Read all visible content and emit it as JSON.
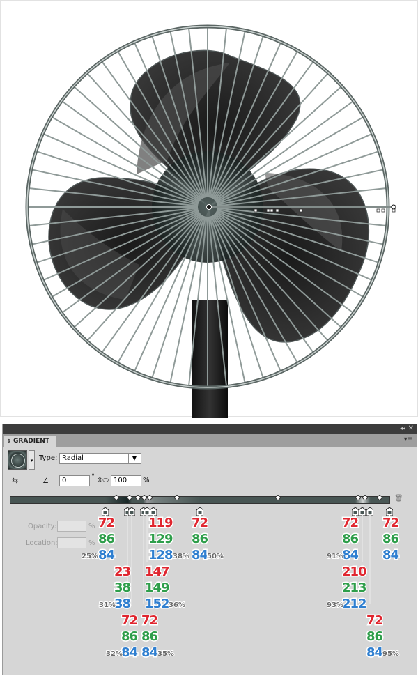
{
  "panel": {
    "tab_label": "GRADIENT",
    "type_label": "Type:",
    "type_value": "Radial",
    "angle_value": "0",
    "degree_sign": "°",
    "aspect_value": "100",
    "percent_sign": "%",
    "opacity_label": "Opacity:",
    "location_label": "Location:",
    "opacity_unit": "%",
    "location_unit": "%"
  },
  "stops": [
    {
      "r": "72",
      "g": "86",
      "b": "84",
      "pct": "25%"
    },
    {
      "r": "23",
      "g": "38",
      "b": "38",
      "pct": "31%"
    },
    {
      "r": "72",
      "g": "86",
      "b": "84",
      "pct": "32%"
    },
    {
      "r": "72",
      "g": "86",
      "b": "84",
      "pct": "35%"
    },
    {
      "r": "147",
      "g": "149",
      "b": "152",
      "pct": "36%"
    },
    {
      "r": "119",
      "g": "129",
      "b": "128",
      "pct": "38%"
    },
    {
      "r": "72",
      "g": "86",
      "b": "84",
      "pct": "50%"
    },
    {
      "r": "72",
      "g": "86",
      "b": "84",
      "pct": "91%"
    },
    {
      "r": "210",
      "g": "213",
      "b": "212",
      "pct": "93%"
    },
    {
      "r": "72",
      "g": "86",
      "b": "84",
      "pct": "95%"
    },
    {
      "r": "72",
      "g": "86",
      "b": "84",
      "pct": ""
    }
  ],
  "colors": {
    "red": "#e0262f",
    "green": "#2e9e4a",
    "blue": "#2f7fd0",
    "gradient_base": "#485654"
  }
}
